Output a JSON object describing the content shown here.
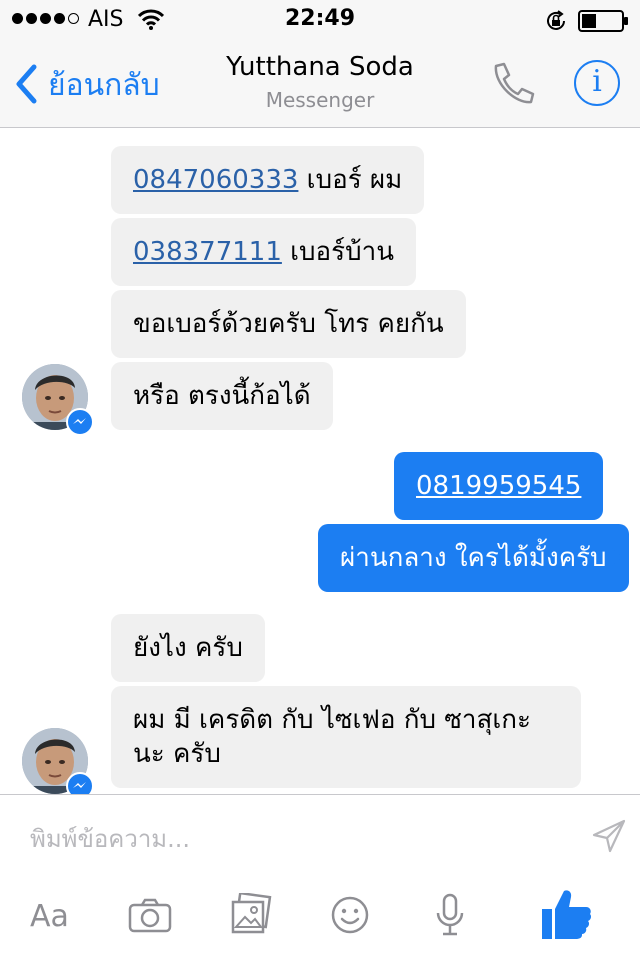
{
  "status_bar": {
    "carrier": "AIS",
    "time": "22:49"
  },
  "header": {
    "back_label": "ย้อนกลับ",
    "title": "Yutthana Soda",
    "subtitle": "Messenger",
    "info_label": "i"
  },
  "messages": [
    {
      "from": "contact",
      "link": "0847060333",
      "text": " เบอร์ ผม"
    },
    {
      "from": "contact",
      "link": "038377111",
      "text": " เบอร์บ้าน"
    },
    {
      "from": "contact",
      "text": "ขอเบอร์ด้วยครับ โทร คยกัน"
    },
    {
      "from": "contact",
      "text": "หรือ ตรงนี้ก้อได้"
    },
    {
      "from": "me",
      "link": "0819959545"
    },
    {
      "from": "me",
      "text": "ผ่านกลาง ใครได้มั้งครับ"
    },
    {
      "from": "contact",
      "text": "ยังไง ครับ"
    },
    {
      "from": "contact",
      "text": "ผม มี เครดิต กับ ไซเฟอ กับ ซาสุเกะ นะ ครับ"
    }
  ],
  "composer": {
    "placeholder": "พิมพ์ข้อความ...",
    "text_format_label": "Aa"
  },
  "icons": {
    "back": "chevron-left-icon",
    "phone": "phone-icon",
    "info": "info-icon",
    "send": "send-icon",
    "camera": "camera-icon",
    "gallery": "photo-gallery-icon",
    "emoji": "emoji-icon",
    "mic": "microphone-icon",
    "like": "thumbs-up-icon"
  },
  "colors": {
    "accent": "#1c7ef2",
    "incoming_bubble": "#f0f0f0",
    "link": "#2a61a8",
    "muted": "#8e8e93"
  }
}
